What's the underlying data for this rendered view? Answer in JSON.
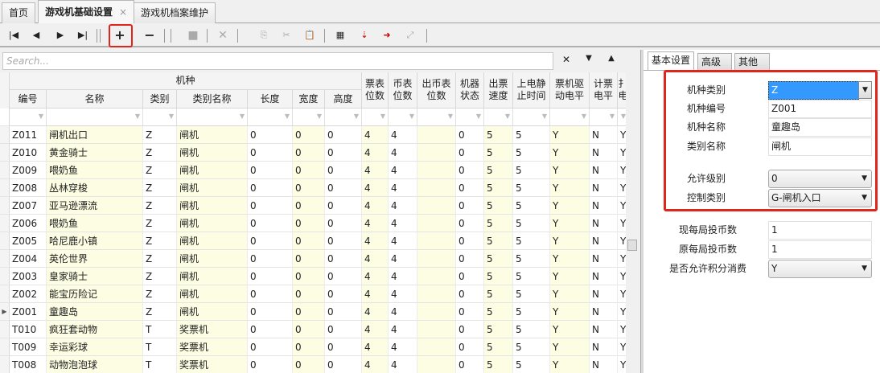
{
  "tabs": [
    {
      "label": "首页"
    },
    {
      "label": "游戏机基础设置",
      "close": "×"
    },
    {
      "label": "游戏机档案维护"
    }
  ],
  "search": {
    "placeholder": "Search..."
  },
  "search_buttons": {
    "clear": "✕",
    "down": "🡇",
    "up": "🡅"
  },
  "grid": {
    "group_header": "机种",
    "columns": [
      "编号",
      "名称",
      "类别",
      "类别名称",
      "长度",
      "宽度",
      "高度",
      "票表\n位数",
      "币表\n位数",
      "出币表\n位数",
      "机器\n状态",
      "出票\n速度",
      "上电静\n止时间",
      "票机驱\n动电平",
      "计票\n电平",
      "扌\n电"
    ],
    "rows": [
      [
        "Z011",
        "闸机出口",
        "Z",
        "闸机",
        "0",
        "0",
        "0",
        "4",
        "4",
        "",
        "0",
        "5",
        "5",
        "Y",
        "N",
        "Y"
      ],
      [
        "Z010",
        "黄金骑士",
        "Z",
        "闸机",
        "0",
        "0",
        "0",
        "4",
        "4",
        "",
        "0",
        "5",
        "5",
        "Y",
        "N",
        "Y"
      ],
      [
        "Z009",
        "喂奶鱼",
        "Z",
        "闸机",
        "0",
        "0",
        "0",
        "4",
        "4",
        "",
        "0",
        "5",
        "5",
        "Y",
        "N",
        "Y"
      ],
      [
        "Z008",
        "丛林穿梭",
        "Z",
        "闸机",
        "0",
        "0",
        "0",
        "4",
        "4",
        "",
        "0",
        "5",
        "5",
        "Y",
        "N",
        "Y"
      ],
      [
        "Z007",
        "亚马逊漂流",
        "Z",
        "闸机",
        "0",
        "0",
        "0",
        "4",
        "4",
        "",
        "0",
        "5",
        "5",
        "Y",
        "N",
        "Y"
      ],
      [
        "Z006",
        "喂奶鱼",
        "Z",
        "闸机",
        "0",
        "0",
        "0",
        "4",
        "4",
        "",
        "0",
        "5",
        "5",
        "Y",
        "N",
        "Y"
      ],
      [
        "Z005",
        "哈尼鹿小镇",
        "Z",
        "闸机",
        "0",
        "0",
        "0",
        "4",
        "4",
        "",
        "0",
        "5",
        "5",
        "Y",
        "N",
        "Y"
      ],
      [
        "Z004",
        "英伦世界",
        "Z",
        "闸机",
        "0",
        "0",
        "0",
        "4",
        "4",
        "",
        "0",
        "5",
        "5",
        "Y",
        "N",
        "Y"
      ],
      [
        "Z003",
        "皇家骑士",
        "Z",
        "闸机",
        "0",
        "0",
        "0",
        "4",
        "4",
        "",
        "0",
        "5",
        "5",
        "Y",
        "N",
        "Y"
      ],
      [
        "Z002",
        "能宝历险记",
        "Z",
        "闸机",
        "0",
        "0",
        "0",
        "4",
        "4",
        "",
        "0",
        "5",
        "5",
        "Y",
        "N",
        "Y"
      ],
      [
        "Z001",
        "童趣岛",
        "Z",
        "闸机",
        "0",
        "0",
        "0",
        "4",
        "4",
        "",
        "0",
        "5",
        "5",
        "Y",
        "N",
        "Y"
      ],
      [
        "T010",
        "疯狂套动物",
        "T",
        "奖票机",
        "0",
        "0",
        "0",
        "4",
        "4",
        "",
        "0",
        "5",
        "5",
        "Y",
        "N",
        "Y"
      ],
      [
        "T009",
        "幸运彩球",
        "T",
        "奖票机",
        "0",
        "0",
        "0",
        "4",
        "4",
        "",
        "0",
        "5",
        "5",
        "Y",
        "N",
        "Y"
      ],
      [
        "T008",
        "动物泡泡球",
        "T",
        "奖票机",
        "0",
        "0",
        "0",
        "4",
        "4",
        "",
        "0",
        "5",
        "5",
        "Y",
        "N",
        "Y"
      ]
    ],
    "current_row": 10
  },
  "panel": {
    "tabs": [
      "基本设置",
      "高级",
      "其他"
    ],
    "fields": [
      {
        "label": "机种类别",
        "value": "Z"
      },
      {
        "label": "机种编号",
        "value": "Z001"
      },
      {
        "label": "机种名称",
        "value": "童趣岛"
      },
      {
        "label": "类别名称",
        "value": "闸机"
      },
      {
        "label": "允许级别",
        "value": "0"
      },
      {
        "label": "控制类别",
        "value": "G-闸机入口"
      },
      {
        "label": "现每局投币数",
        "value": "1"
      },
      {
        "label": "原每局投币数",
        "value": "1"
      },
      {
        "label": "是否允许积分消费",
        "value": "Y"
      }
    ]
  },
  "accent_color": "#e0251b"
}
